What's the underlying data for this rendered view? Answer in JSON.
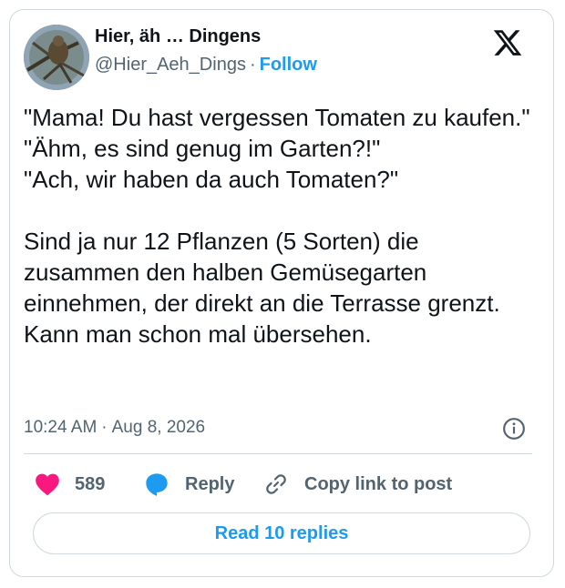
{
  "author": {
    "display_name": "Hier, äh … Dingens",
    "handle": "@Hier_Aeh_Dings",
    "separator": "·",
    "follow_label": "Follow",
    "avatar_icon": "profile-photo-bird-on-branch"
  },
  "brand": {
    "icon": "x-logo-icon"
  },
  "tweet": {
    "text": "\"Mama! Du hast vergessen Tomaten zu kaufen.\"\n\"Ähm, es sind genug im Garten?!\"\n\"Ach, wir haben da auch Tomaten?\"\n\nSind ja nur 12 Pflanzen (5 Sorten) die zusammen den halben Gemüsegarten einnehmen, der direkt an die Terrasse grenzt. Kann man schon mal übersehen.",
    "time": "10:24 AM",
    "separator": "·",
    "date": "Aug 8, 2026"
  },
  "actions": {
    "like_count": "589",
    "reply_label": "Reply",
    "copy_link_label": "Copy link to post"
  },
  "footer": {
    "read_replies_label": "Read 10 replies"
  },
  "colors": {
    "accent": "#1d9bf0",
    "like": "#f91880",
    "text": "#0f1419",
    "secondary_text": "#536471",
    "border": "#cfd9de"
  }
}
